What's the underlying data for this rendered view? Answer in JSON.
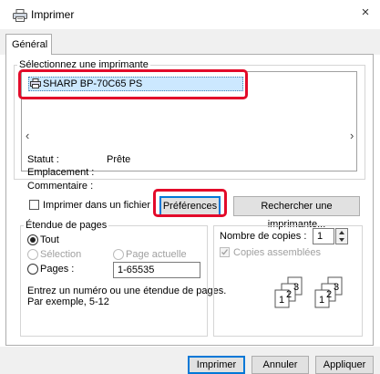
{
  "window": {
    "title": "Imprimer",
    "close_symbol": "×"
  },
  "tabs": [
    {
      "label": "Général",
      "active": true
    }
  ],
  "printer_group": {
    "legend": "Sélectionnez une imprimante",
    "printers": [
      {
        "name": "SHARP BP-70C65 PS",
        "selected": true
      }
    ]
  },
  "status": {
    "statut_label": "Statut :",
    "statut_value": "Prête",
    "emplacement_label": "Emplacement :",
    "emplacement_value": "",
    "commentaire_label": "Commentaire :",
    "commentaire_value": ""
  },
  "print_to_file": {
    "label": "Imprimer dans un fichier",
    "checked": false
  },
  "buttons": {
    "preferences": "Préférences",
    "find_printer": "Rechercher une imprimante...",
    "print": "Imprimer",
    "cancel": "Annuler",
    "apply": "Appliquer"
  },
  "page_range": {
    "legend": "Étendue de pages",
    "all": "Tout",
    "selection": "Sélection",
    "current_page": "Page actuelle",
    "pages": "Pages :",
    "pages_value": "1-65535",
    "selected_option": "all",
    "hint_line1": "Entrez un numéro ou une étendue de pages.",
    "hint_line2": "Par exemple, 5-12"
  },
  "copies": {
    "count_label": "Nombre de copies :",
    "count_value": "1",
    "collate_label": "Copies assemblées",
    "collate_checked": true,
    "collate_enabled": false
  },
  "colors": {
    "highlight": "#e30b2a",
    "selection": "#cce8ff",
    "default_border": "#0078d7"
  }
}
